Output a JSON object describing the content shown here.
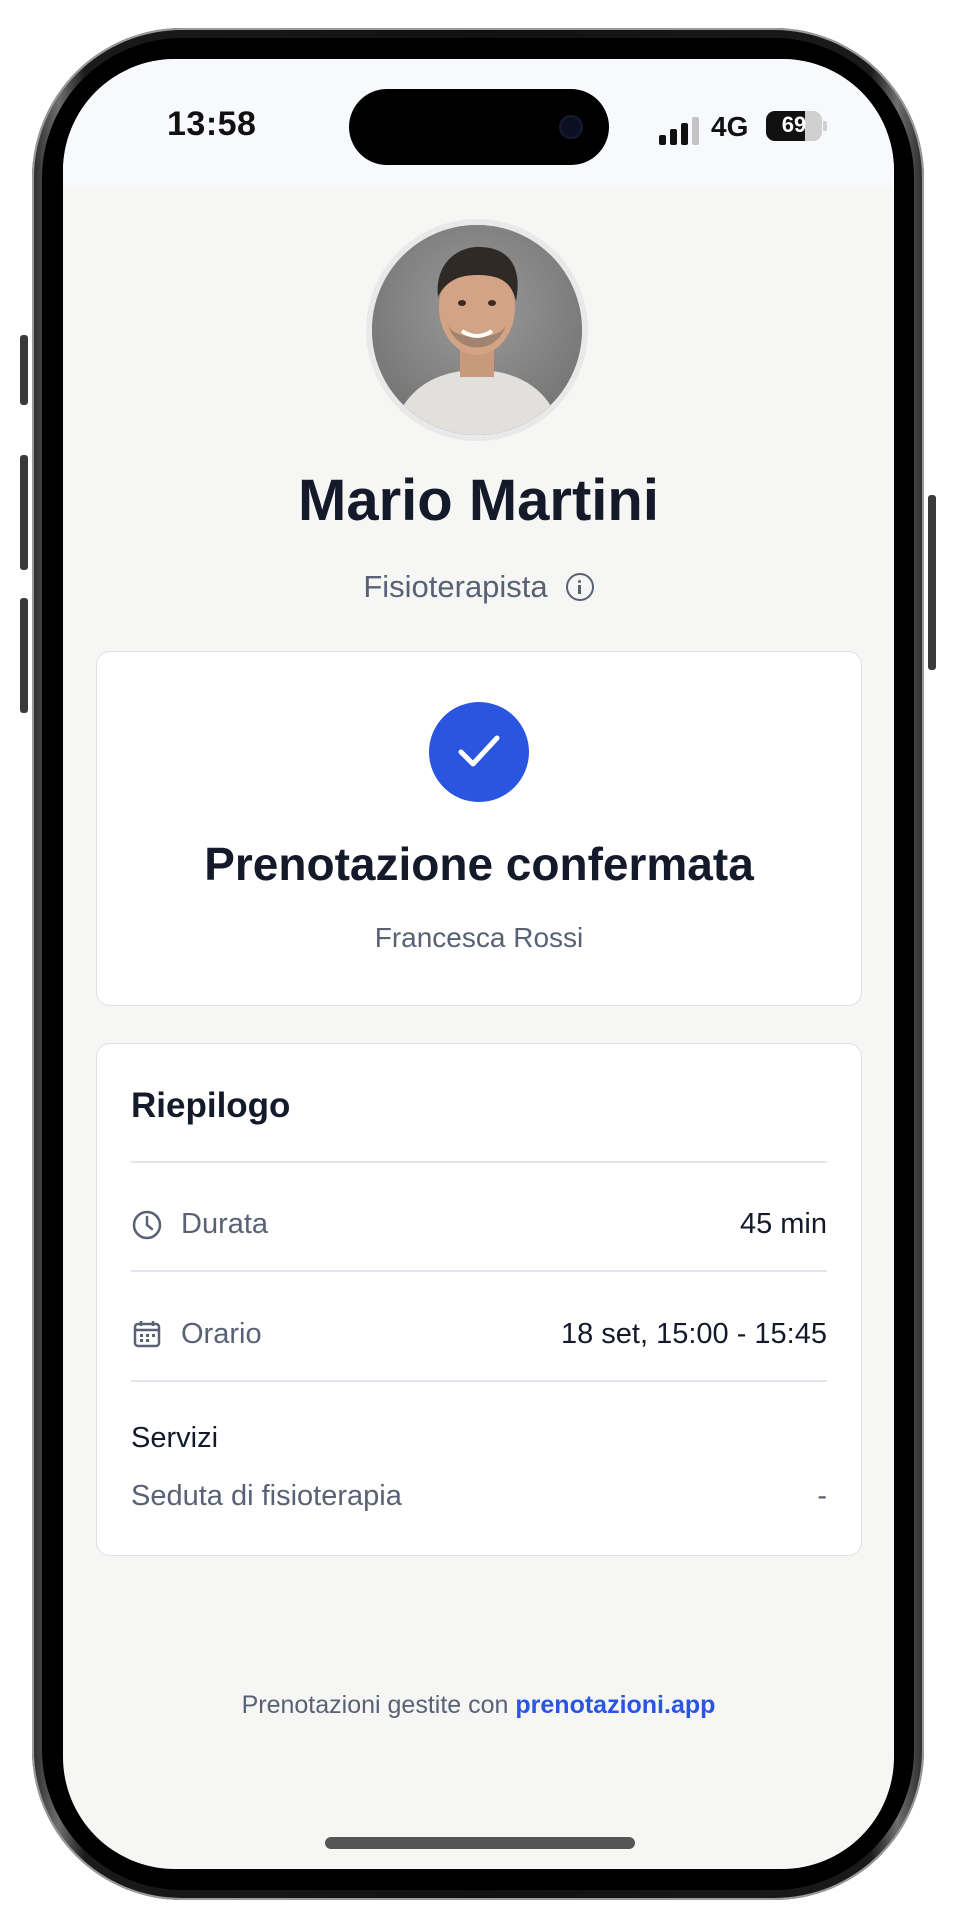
{
  "status_bar": {
    "time": "13:58",
    "network": "4G",
    "battery": "69",
    "battery_level": 0.69
  },
  "profile": {
    "name": "Mario Martini",
    "role": "Fisioterapista"
  },
  "confirmation": {
    "title": "Prenotazione confermata",
    "client": "Francesca Rossi"
  },
  "summary": {
    "title": "Riepilogo",
    "duration": {
      "label": "Durata",
      "value": "45 min"
    },
    "time": {
      "label": "Orario",
      "value": "18 set, 15:00 - 15:45"
    },
    "services_title": "Servizi",
    "services": [
      {
        "name": "Seduta di fisioterapia",
        "price": "-"
      }
    ]
  },
  "footer": {
    "text": "Prenotazioni gestite con",
    "link": "prenotazioni.app"
  },
  "colors": {
    "accent": "#2a55e0",
    "text_dark": "#151a2b",
    "text_muted": "#596175",
    "background": "#f6f6f5"
  }
}
